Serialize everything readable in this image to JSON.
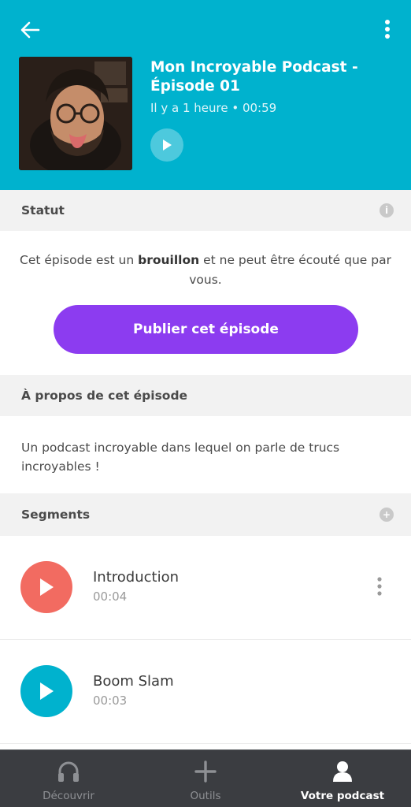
{
  "header": {
    "episode_title": "Mon Incroyable Podcast - Épisode 01",
    "episode_meta": "Il y a 1 heure • 00:59",
    "bg_color": "#00b2ce",
    "icons": {
      "back": "arrow-left-icon",
      "menu": "more-vertical-icon",
      "play": "play-icon"
    }
  },
  "status_section": {
    "title": "Statut",
    "info_icon": "info-icon",
    "text_before": "Cet épisode est un",
    "text_bold": "brouillon",
    "text_after": "et ne peut être écouté que par vous.",
    "publish_label": "Publier cet épisode",
    "publish_color": "#8c3cf0"
  },
  "about_section": {
    "title": "À propos de cet épisode",
    "description": "Un podcast incroyable dans lequel on parle de trucs incroyables !"
  },
  "segments_section": {
    "title": "Segments",
    "add_icon": "plus-circle-icon",
    "items": [
      {
        "title": "Introduction",
        "duration": "00:04",
        "color": "#f26b61",
        "has_menu": true
      },
      {
        "title": "Boom Slam",
        "duration": "00:03",
        "color": "#00b2ce",
        "has_menu": false
      }
    ]
  },
  "bottom_nav": {
    "items": [
      {
        "label": "Découvrir",
        "icon": "headphones-icon",
        "active": false
      },
      {
        "label": "Outils",
        "icon": "plus-icon",
        "active": false
      },
      {
        "label": "Votre podcast",
        "icon": "user-icon",
        "active": true
      }
    ]
  }
}
